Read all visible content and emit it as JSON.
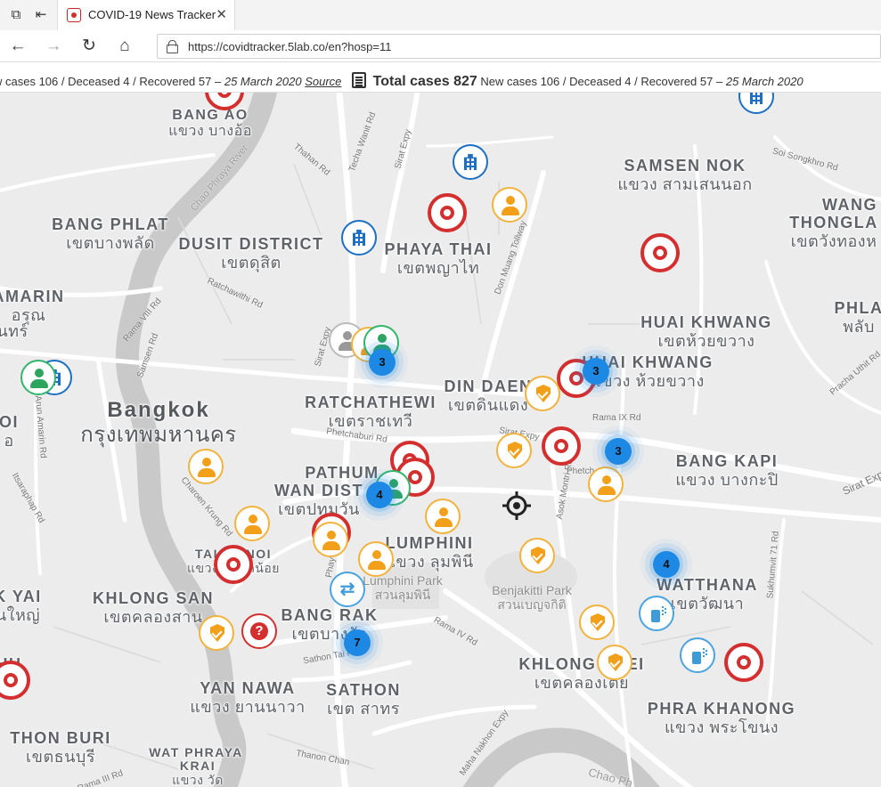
{
  "browser": {
    "tab_title": "COVID-19 News Tracker",
    "close_glyph": "✕",
    "url": "https://covidtracker.5lab.co/en?hosp=11"
  },
  "ticker": {
    "a_newcases_label": "w cases 106",
    "a_deceased": "Deceased 4",
    "a_recovered": "Recovered 57",
    "a_date": "25 March 2020",
    "a_source": "Source",
    "b_total": "Total cases 827",
    "b_newcases": "New cases 106",
    "b_deceased": "Deceased 4",
    "b_recovered": "Recovered 57",
    "b_date": "25 March 2020",
    "separator": "/",
    "dash": "–"
  },
  "map": {
    "labels": [
      {
        "en": "BANG AO",
        "th": "แขวง บางอ้อ"
      },
      {
        "en": "SAMSEN NOK",
        "th": "แขวง สามเสนนอก"
      },
      {
        "en": "BANG PHLAT",
        "th": "เขตบางพลัด"
      },
      {
        "en": "DUSIT DISTRICT",
        "th": "เขตดุสิต"
      },
      {
        "en": "PHAYA THAI",
        "th": "เขตพญาไท"
      },
      {
        "en": "WANG",
        "th": ""
      },
      {
        "en": "THONGLA",
        "th": "เขตวังทองห"
      },
      {
        "en": "AMARIN",
        "th": "อรุณ"
      },
      {
        "en": "",
        "th": "นทร์"
      },
      {
        "en": "HUAI KHWANG",
        "th": "เขตห้วยขวาง"
      },
      {
        "en": "PHLA",
        "th": "พลับ"
      },
      {
        "en": "HUAI KHWANG",
        "th": "แขวง ห้วยขวาง"
      },
      {
        "en": "DIN DAEN",
        "th": "เขตดินแดง"
      },
      {
        "en": "RATCHATHEWI",
        "th": "เขตราชเทวี"
      },
      {
        "en": "Bangkok",
        "th": "กรุงเทพมหานคร"
      },
      {
        "en": "OI",
        "th": "อ"
      },
      {
        "en": "BANG KAPI",
        "th": "แขวง บางกะปิ"
      },
      {
        "en": "PATHUM",
        "th": ""
      },
      {
        "en": "WAN DIST",
        "th": "เขตปทุมวัน"
      },
      {
        "en": "LUMPHINI",
        "th": "แขวง ลุมพินี"
      },
      {
        "en": "TALAT NOI",
        "th": "แขวง ตลาดน้อย"
      },
      {
        "en": "K YAI",
        "th": "นใหญ่"
      },
      {
        "en": "KHLONG SAN",
        "th": "เขตคลองสาน"
      },
      {
        "en": "WATTHANA",
        "th": "เขตวัฒนา"
      },
      {
        "en": "BANG RAK",
        "th": "เขตบางรัก"
      },
      {
        "en": "KHLONG TOEI",
        "th": "เขตคลองเตย"
      },
      {
        "en": "YAN NAWA",
        "th": "แขวง ยานนาวา"
      },
      {
        "en": "SATHON",
        "th": "เขต สาทร"
      },
      {
        "en": "PHRA KHANONG",
        "th": "แขวง พระโขนง"
      },
      {
        "en": "THON BURI",
        "th": "เขตธนบุรี"
      },
      {
        "en": "WAT PHRAYA",
        "th": ""
      },
      {
        "en": "KRAI",
        "th": "แขวง วัด"
      },
      {
        "en": "HU",
        "th": ""
      }
    ],
    "parks": [
      {
        "en": "Lumphini Park",
        "th": "สวนลุมพินี"
      },
      {
        "en": "Benjakitti Park",
        "th": "สวนเบญจกิติ"
      }
    ],
    "roads": [
      "Sirat Expy",
      "Don Muang Tollway",
      "Thahan Rd",
      "Techa Wanit Rd",
      "Chao Phraya River",
      "Ratchawithi Rd",
      "Rama VIII Rd",
      "Samsen Rd",
      "Sirat Expy",
      "Rama IX Rd",
      "Sirat Expy",
      "Phetchaburi Rd",
      "Asok Montri Rd",
      "Phetch",
      "Charoen Krung Rd",
      "Itsaraphap Rd",
      "Arun Amarin Rd",
      "Rama IV Rd",
      "Sathon Tai Rd",
      "Sukhumvit 71 Rd",
      "Pracha Uthit Rd",
      "Soi Songkhro Rd",
      "Maha Nakhon Expy",
      "Thanon Chan",
      "Rama III Rd",
      "Chao Ph",
      "Phay",
      "Sukhumvit 71 Rd"
    ],
    "clusters": [
      {
        "count": "3"
      },
      {
        "count": "3"
      },
      {
        "count": "3"
      },
      {
        "count": "4"
      },
      {
        "count": "4"
      },
      {
        "count": "7"
      }
    ]
  }
}
